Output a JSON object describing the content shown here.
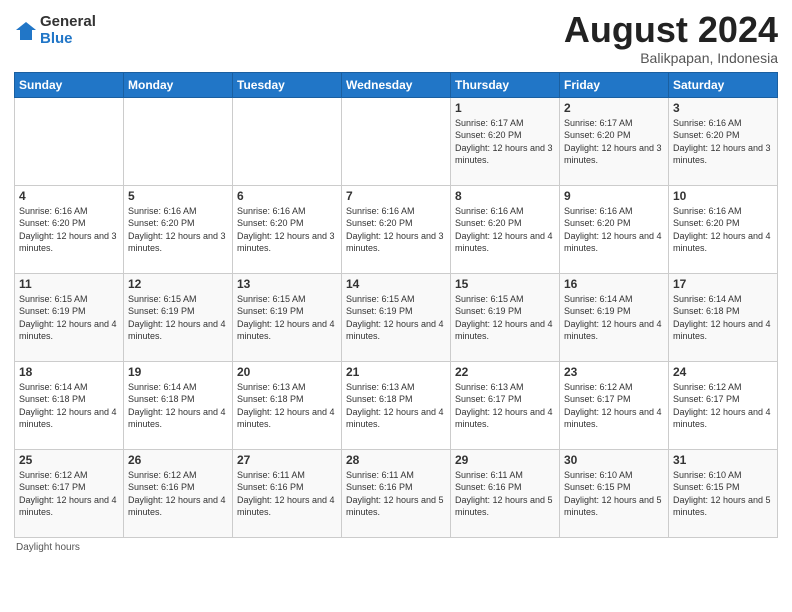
{
  "logo": {
    "general": "General",
    "blue": "Blue"
  },
  "title": "August 2024",
  "subtitle": "Balikpapan, Indonesia",
  "days_of_week": [
    "Sunday",
    "Monday",
    "Tuesday",
    "Wednesday",
    "Thursday",
    "Friday",
    "Saturday"
  ],
  "footer": "Daylight hours",
  "weeks": [
    [
      {
        "day": "",
        "info": ""
      },
      {
        "day": "",
        "info": ""
      },
      {
        "day": "",
        "info": ""
      },
      {
        "day": "",
        "info": ""
      },
      {
        "day": "1",
        "info": "Sunrise: 6:17 AM\nSunset: 6:20 PM\nDaylight: 12 hours and 3 minutes."
      },
      {
        "day": "2",
        "info": "Sunrise: 6:17 AM\nSunset: 6:20 PM\nDaylight: 12 hours and 3 minutes."
      },
      {
        "day": "3",
        "info": "Sunrise: 6:16 AM\nSunset: 6:20 PM\nDaylight: 12 hours and 3 minutes."
      }
    ],
    [
      {
        "day": "4",
        "info": "Sunrise: 6:16 AM\nSunset: 6:20 PM\nDaylight: 12 hours and 3 minutes."
      },
      {
        "day": "5",
        "info": "Sunrise: 6:16 AM\nSunset: 6:20 PM\nDaylight: 12 hours and 3 minutes."
      },
      {
        "day": "6",
        "info": "Sunrise: 6:16 AM\nSunset: 6:20 PM\nDaylight: 12 hours and 3 minutes."
      },
      {
        "day": "7",
        "info": "Sunrise: 6:16 AM\nSunset: 6:20 PM\nDaylight: 12 hours and 3 minutes."
      },
      {
        "day": "8",
        "info": "Sunrise: 6:16 AM\nSunset: 6:20 PM\nDaylight: 12 hours and 4 minutes."
      },
      {
        "day": "9",
        "info": "Sunrise: 6:16 AM\nSunset: 6:20 PM\nDaylight: 12 hours and 4 minutes."
      },
      {
        "day": "10",
        "info": "Sunrise: 6:16 AM\nSunset: 6:20 PM\nDaylight: 12 hours and 4 minutes."
      }
    ],
    [
      {
        "day": "11",
        "info": "Sunrise: 6:15 AM\nSunset: 6:19 PM\nDaylight: 12 hours and 4 minutes."
      },
      {
        "day": "12",
        "info": "Sunrise: 6:15 AM\nSunset: 6:19 PM\nDaylight: 12 hours and 4 minutes."
      },
      {
        "day": "13",
        "info": "Sunrise: 6:15 AM\nSunset: 6:19 PM\nDaylight: 12 hours and 4 minutes."
      },
      {
        "day": "14",
        "info": "Sunrise: 6:15 AM\nSunset: 6:19 PM\nDaylight: 12 hours and 4 minutes."
      },
      {
        "day": "15",
        "info": "Sunrise: 6:15 AM\nSunset: 6:19 PM\nDaylight: 12 hours and 4 minutes."
      },
      {
        "day": "16",
        "info": "Sunrise: 6:14 AM\nSunset: 6:19 PM\nDaylight: 12 hours and 4 minutes."
      },
      {
        "day": "17",
        "info": "Sunrise: 6:14 AM\nSunset: 6:18 PM\nDaylight: 12 hours and 4 minutes."
      }
    ],
    [
      {
        "day": "18",
        "info": "Sunrise: 6:14 AM\nSunset: 6:18 PM\nDaylight: 12 hours and 4 minutes."
      },
      {
        "day": "19",
        "info": "Sunrise: 6:14 AM\nSunset: 6:18 PM\nDaylight: 12 hours and 4 minutes."
      },
      {
        "day": "20",
        "info": "Sunrise: 6:13 AM\nSunset: 6:18 PM\nDaylight: 12 hours and 4 minutes."
      },
      {
        "day": "21",
        "info": "Sunrise: 6:13 AM\nSunset: 6:18 PM\nDaylight: 12 hours and 4 minutes."
      },
      {
        "day": "22",
        "info": "Sunrise: 6:13 AM\nSunset: 6:17 PM\nDaylight: 12 hours and 4 minutes."
      },
      {
        "day": "23",
        "info": "Sunrise: 6:12 AM\nSunset: 6:17 PM\nDaylight: 12 hours and 4 minutes."
      },
      {
        "day": "24",
        "info": "Sunrise: 6:12 AM\nSunset: 6:17 PM\nDaylight: 12 hours and 4 minutes."
      }
    ],
    [
      {
        "day": "25",
        "info": "Sunrise: 6:12 AM\nSunset: 6:17 PM\nDaylight: 12 hours and 4 minutes."
      },
      {
        "day": "26",
        "info": "Sunrise: 6:12 AM\nSunset: 6:16 PM\nDaylight: 12 hours and 4 minutes."
      },
      {
        "day": "27",
        "info": "Sunrise: 6:11 AM\nSunset: 6:16 PM\nDaylight: 12 hours and 4 minutes."
      },
      {
        "day": "28",
        "info": "Sunrise: 6:11 AM\nSunset: 6:16 PM\nDaylight: 12 hours and 5 minutes."
      },
      {
        "day": "29",
        "info": "Sunrise: 6:11 AM\nSunset: 6:16 PM\nDaylight: 12 hours and 5 minutes."
      },
      {
        "day": "30",
        "info": "Sunrise: 6:10 AM\nSunset: 6:15 PM\nDaylight: 12 hours and 5 minutes."
      },
      {
        "day": "31",
        "info": "Sunrise: 6:10 AM\nSunset: 6:15 PM\nDaylight: 12 hours and 5 minutes."
      }
    ]
  ]
}
